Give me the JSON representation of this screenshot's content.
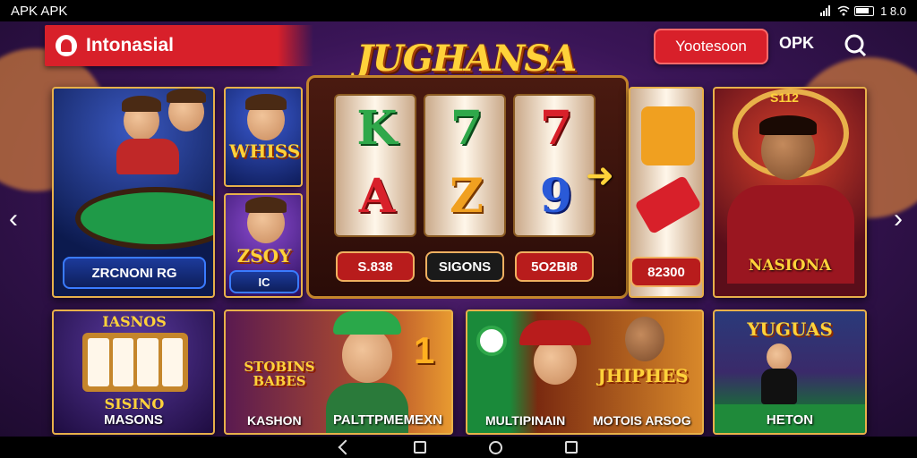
{
  "status_bar": {
    "left_text": "APK APK",
    "time": "1 8.0"
  },
  "header": {
    "brand": "Intonasial",
    "game_logo": "JUGHANSA",
    "button_label": "Yootesoon",
    "link_label": "OPK",
    "search_icon": "search-icon"
  },
  "cards": {
    "poker": {
      "label": "ZRCNONI RG"
    },
    "small_top": {
      "label": "WHISS"
    },
    "small_bottom": {
      "label": "ZSOY",
      "pill": "IC"
    },
    "reels": {
      "symbols": [
        "K",
        "7",
        "7",
        "A",
        "Z",
        "9"
      ],
      "values": [
        "S.838",
        "SIGONS",
        "5O2BI8"
      ]
    },
    "reel_side": {
      "value": "82300"
    },
    "hero": {
      "label": "NASIONA",
      "sign": "S112"
    },
    "slots": {
      "title": "IASNOS",
      "label": "MASONS",
      "sublabel": "SISINO"
    },
    "stobins": {
      "title": "STOBINS BABES",
      "label": "KASHON",
      "label2": "PALTTPMEMEXN"
    },
    "multi": {
      "title": "JHIPHES",
      "label": "MULTIPINAIN",
      "label2": "MOTOIS ARSOG"
    },
    "sport": {
      "title": "YUGUAS",
      "label": "HETON"
    }
  },
  "colors": {
    "accent": "#d8202a",
    "gold": "#e8b14a",
    "bg": "#3a1557"
  }
}
